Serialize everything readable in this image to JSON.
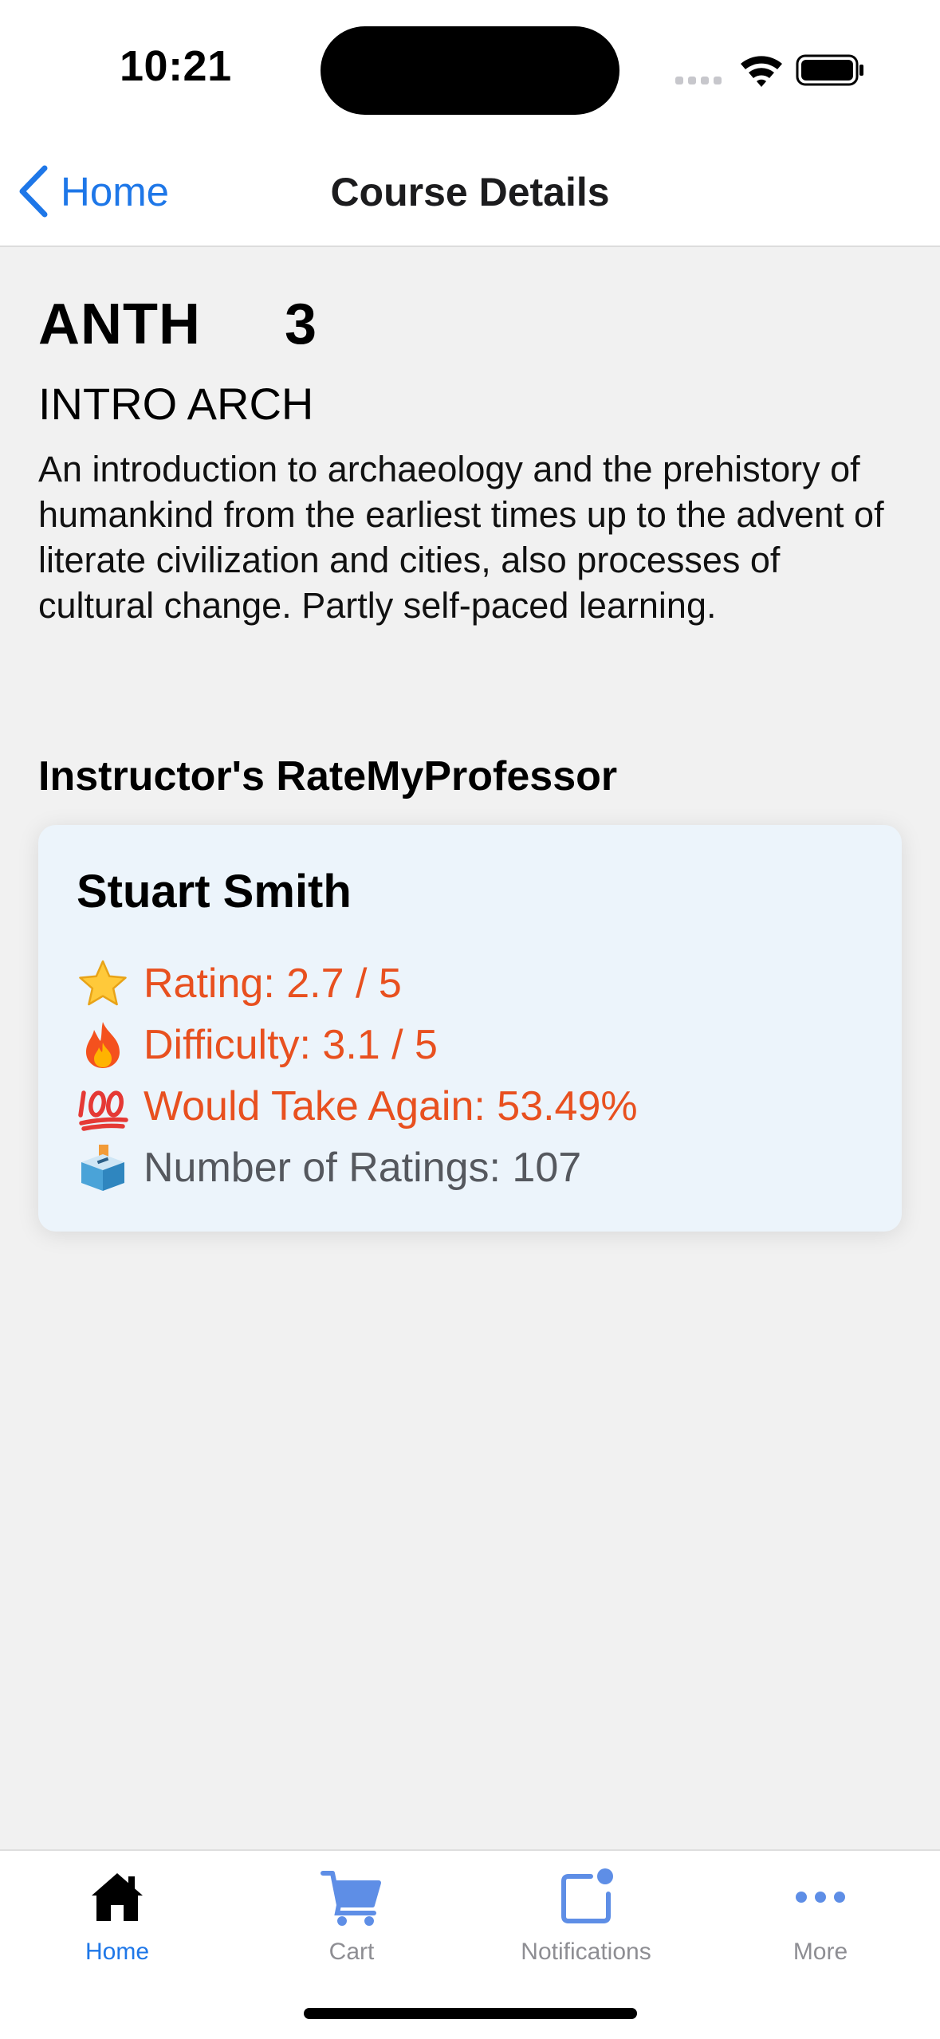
{
  "status_bar": {
    "time": "10:21"
  },
  "nav": {
    "back_label": "Home",
    "title": "Course Details"
  },
  "course": {
    "subject": "ANTH",
    "number": "3",
    "name": "INTRO ARCH",
    "description": "An introduction to archaeology and the prehistory of humankind from the earliest times up to the advent of literate civilization and cities, also processes of cultural change. Partly self-paced learning."
  },
  "instructor_section": {
    "heading": "Instructor's RateMyProfessor",
    "name": "Stuart Smith",
    "stats": [
      {
        "icon": "star-icon",
        "text": "Rating: 2.7 / 5"
      },
      {
        "icon": "fire-icon",
        "text": "Difficulty: 3.1 / 5"
      },
      {
        "icon": "hundred-points-icon",
        "text": "Would Take Again: 53.49%"
      },
      {
        "icon": "ballot-box-icon",
        "text": "Number of Ratings: 107"
      }
    ],
    "colors": {
      "highlight": "#e8501f",
      "neutral": "#55585e",
      "card_background": "#ecf4fb"
    }
  },
  "tabs": [
    {
      "label": "Home",
      "icon": "house-icon",
      "active": true
    },
    {
      "label": "Cart",
      "icon": "cart-icon",
      "active": false
    },
    {
      "label": "Notifications",
      "icon": "notification-icon",
      "active": false
    },
    {
      "label": "More",
      "icon": "more-icon",
      "active": false
    }
  ],
  "colors": {
    "accent": "#1e77e8",
    "inactive_icon": "#5e8ee6",
    "inactive_label": "#8e8e93",
    "background": "#f1f1f1"
  }
}
